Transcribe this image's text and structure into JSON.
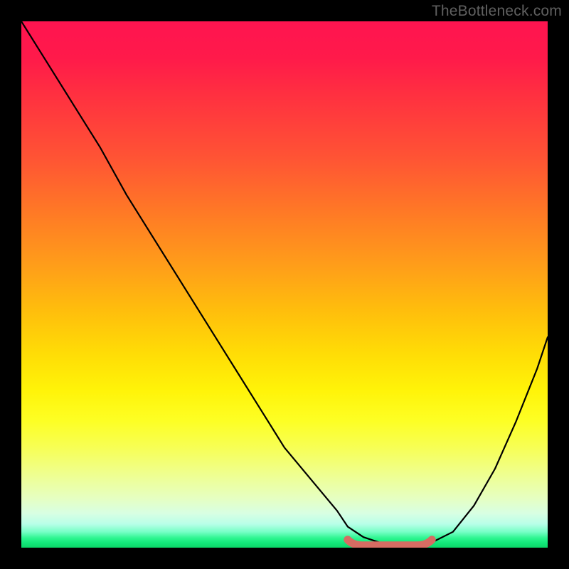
{
  "watermark": "TheBottleneck.com",
  "chart_data": {
    "type": "line",
    "title": "",
    "xlabel": "",
    "ylabel": "",
    "xlim": [
      0,
      100
    ],
    "ylim": [
      0,
      100
    ],
    "series": [
      {
        "name": "bottleneck-curve",
        "x": [
          0,
          5,
          10,
          15,
          20,
          25,
          30,
          35,
          40,
          45,
          50,
          55,
          60,
          62,
          65,
          68,
          72,
          75,
          78,
          82,
          86,
          90,
          94,
          98,
          100
        ],
        "values": [
          100,
          92,
          84,
          76,
          67,
          59,
          51,
          43,
          35,
          27,
          19,
          13,
          7,
          4,
          2,
          1,
          0,
          0,
          1,
          3,
          8,
          15,
          24,
          34,
          40
        ]
      }
    ],
    "marker": {
      "name": "optimal-range",
      "x": [
        62,
        78
      ],
      "y": [
        0.7,
        0.7
      ]
    },
    "gradient_stops": [
      {
        "pos": 0,
        "color": "#ff1450"
      },
      {
        "pos": 50,
        "color": "#ffbe0c"
      },
      {
        "pos": 80,
        "color": "#f7ff55"
      },
      {
        "pos": 100,
        "color": "#0cd768"
      }
    ]
  }
}
